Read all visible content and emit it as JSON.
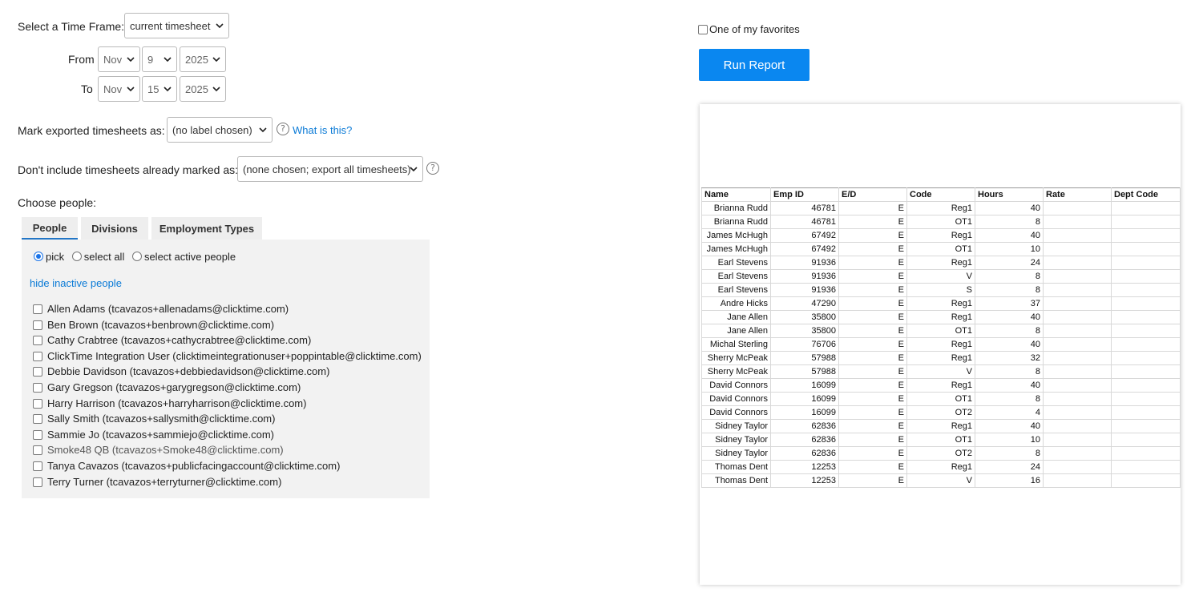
{
  "time_frame": {
    "label": "Select a Time Frame:",
    "value": "current timesheet"
  },
  "from": {
    "label": "From",
    "month": "Nov",
    "day": "9",
    "year": "2025"
  },
  "to": {
    "label": "To",
    "month": "Nov",
    "day": "15",
    "year": "2025"
  },
  "mark_exported": {
    "label": "Mark exported timesheets as:",
    "value": "(no label chosen)",
    "help_link": "What is this?"
  },
  "dont_include": {
    "label": "Don't include timesheets already marked as:",
    "value": "(none chosen; export all timesheets)"
  },
  "choose_people": {
    "label": "Choose people:",
    "tabs": [
      "People",
      "Divisions",
      "Employment Types"
    ],
    "active_tab": "People",
    "radios": [
      "pick",
      "select all",
      "select active people"
    ],
    "selected_radio": "pick",
    "hide_inactive_link": "hide inactive people",
    "people": [
      "Allen Adams (tcavazos+allenadams@clicktime.com)",
      "Ben Brown (tcavazos+benbrown@clicktime.com)",
      "Cathy Crabtree (tcavazos+cathycrabtree@clicktime.com)",
      "ClickTime Integration User (clicktimeintegrationuser+poppintable@clicktime.com)",
      "Debbie Davidson (tcavazos+debbiedavidson@clicktime.com)",
      "Gary Gregson (tcavazos+garygregson@clicktime.com)",
      "Harry Harrison (tcavazos+harryharrison@clicktime.com)",
      "Sally Smith (tcavazos+sallysmith@clicktime.com)",
      "Sammie Jo (tcavazos+sammiejo@clicktime.com)",
      "Smoke48 QB (tcavazos+Smoke48@clicktime.com)",
      "Tanya Cavazos (tcavazos+publicfacingaccount@clicktime.com)",
      "Terry Turner (tcavazos+terryturner@clicktime.com)"
    ]
  },
  "favorites": {
    "label": "One of my favorites",
    "checked": false
  },
  "run_report": {
    "label": "Run Report",
    "color": "#0a87f0"
  },
  "preview": {
    "columns": [
      "Name",
      "Emp ID",
      "E/D",
      "Code",
      "Hours",
      "Rate",
      "Dept Code"
    ],
    "rows": [
      [
        "Brianna Rudd",
        "46781",
        "E",
        "Reg1",
        "40",
        "",
        ""
      ],
      [
        "Brianna Rudd",
        "46781",
        "E",
        "OT1",
        "8",
        "",
        ""
      ],
      [
        "James McHugh",
        "67492",
        "E",
        "Reg1",
        "40",
        "",
        ""
      ],
      [
        "James McHugh",
        "67492",
        "E",
        "OT1",
        "10",
        "",
        ""
      ],
      [
        "Earl Stevens",
        "91936",
        "E",
        "Reg1",
        "24",
        "",
        ""
      ],
      [
        "Earl Stevens",
        "91936",
        "E",
        "V",
        "8",
        "",
        ""
      ],
      [
        "Earl Stevens",
        "91936",
        "E",
        "S",
        "8",
        "",
        ""
      ],
      [
        "Andre Hicks",
        "47290",
        "E",
        "Reg1",
        "37",
        "",
        ""
      ],
      [
        "Jane Allen",
        "35800",
        "E",
        "Reg1",
        "40",
        "",
        ""
      ],
      [
        "Jane Allen",
        "35800",
        "E",
        "OT1",
        "8",
        "",
        ""
      ],
      [
        "Michal Sterling",
        "76706",
        "E",
        "Reg1",
        "40",
        "",
        ""
      ],
      [
        "Sherry McPeak",
        "57988",
        "E",
        "Reg1",
        "32",
        "",
        ""
      ],
      [
        "Sherry McPeak",
        "57988",
        "E",
        "V",
        "8",
        "",
        ""
      ],
      [
        "David Connors",
        "16099",
        "E",
        "Reg1",
        "40",
        "",
        ""
      ],
      [
        "David Connors",
        "16099",
        "E",
        "OT1",
        "8",
        "",
        ""
      ],
      [
        "David Connors",
        "16099",
        "E",
        "OT2",
        "4",
        "",
        ""
      ],
      [
        "Sidney Taylor",
        "62836",
        "E",
        "Reg1",
        "40",
        "",
        ""
      ],
      [
        "Sidney Taylor",
        "62836",
        "E",
        "OT1",
        "10",
        "",
        ""
      ],
      [
        "Sidney Taylor",
        "62836",
        "E",
        "OT2",
        "8",
        "",
        ""
      ],
      [
        "Thomas Dent",
        "12253",
        "E",
        "Reg1",
        "24",
        "",
        ""
      ],
      [
        "Thomas Dent",
        "12253",
        "E",
        "V",
        "16",
        "",
        ""
      ]
    ]
  }
}
